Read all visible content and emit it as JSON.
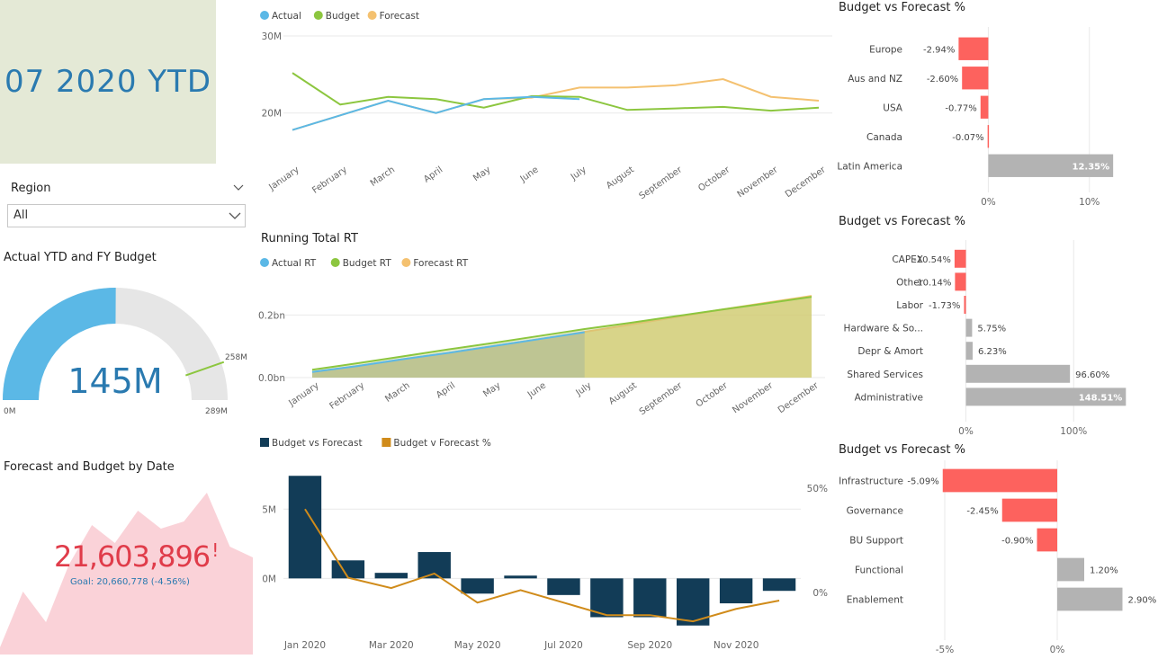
{
  "ytd_card": {
    "text": "07 2020 YTD"
  },
  "slicer": {
    "label": "Region",
    "value": "All"
  },
  "gauge": {
    "title": "Actual YTD and FY Budget",
    "value_label": "145M",
    "value": 145,
    "target": 258,
    "min": 0,
    "max": 289,
    "min_label": "0M",
    "max_label": "289M",
    "target_label": "258M",
    "colors": {
      "fill": "#5bb8e6",
      "track": "#e6e6e6",
      "target": "#8cc63f",
      "text": "#2a7ab0"
    }
  },
  "kpi": {
    "title": "Forecast and Budget by Date",
    "value": "21,603,896",
    "indicator": "!",
    "goal": "Goal: 20,660,778 (-4.56%)",
    "trend": [
      0.04,
      0.35,
      0.18,
      0.5,
      0.72,
      0.62,
      0.8,
      0.7,
      0.74,
      0.9,
      0.6,
      0.54
    ],
    "colors": {
      "value": "#e03c4a",
      "goal": "#2a7ab0",
      "area": "#fad2d8"
    }
  },
  "chart_data": [
    {
      "id": "monthly-line",
      "type": "line",
      "categories": [
        "January",
        "February",
        "March",
        "April",
        "May",
        "June",
        "July",
        "August",
        "September",
        "October",
        "November",
        "December"
      ],
      "series": [
        {
          "name": "Actual",
          "color": "#5bb8e6",
          "values": [
            17.8,
            19.7,
            21.6,
            20.0,
            21.8,
            22.1,
            21.8,
            null,
            null,
            null,
            null,
            null
          ]
        },
        {
          "name": "Budget",
          "color": "#8cc63f",
          "values": [
            25.2,
            21.1,
            22.1,
            21.8,
            20.7,
            22.2,
            22.1,
            20.4,
            20.6,
            20.8,
            20.3,
            20.7
          ]
        },
        {
          "name": "Forecast",
          "color": "#f4c170",
          "values": [
            17.8,
            19.7,
            21.6,
            20.0,
            21.8,
            22.0,
            23.3,
            23.3,
            23.6,
            24.4,
            22.1,
            21.6
          ]
        }
      ],
      "yticks": [
        {
          "v": 20,
          "label": "20M"
        },
        {
          "v": 30,
          "label": "30M"
        }
      ],
      "ylim": [
        16,
        30
      ]
    },
    {
      "id": "running-total",
      "type": "area",
      "title": "Running Total RT",
      "categories": [
        "January",
        "February",
        "March",
        "April",
        "May",
        "June",
        "July",
        "August",
        "September",
        "October",
        "November",
        "December"
      ],
      "series": [
        {
          "name": "Actual RT",
          "color": "#5bb8e6",
          "values": [
            0.018,
            0.037,
            0.059,
            0.079,
            0.101,
            0.123,
            0.145,
            null,
            null,
            null,
            null,
            null
          ]
        },
        {
          "name": "Budget RT",
          "color": "#8cc63f",
          "values": [
            0.025,
            0.046,
            0.068,
            0.09,
            0.111,
            0.133,
            0.155,
            0.175,
            0.196,
            0.217,
            0.237,
            0.258
          ]
        },
        {
          "name": "Forecast RT",
          "color": "#f4c170",
          "values": [
            0.018,
            0.037,
            0.059,
            0.079,
            0.101,
            0.123,
            0.146,
            0.169,
            0.193,
            0.217,
            0.239,
            0.261
          ]
        }
      ],
      "yticks": [
        {
          "v": 0,
          "label": "0.0bn"
        },
        {
          "v": 0.2,
          "label": "0.2bn"
        }
      ],
      "ylim": [
        0,
        0.27
      ]
    },
    {
      "id": "combo",
      "type": "bar",
      "categories": [
        "Jan 2020",
        "Feb 2020",
        "Mar 2020",
        "Apr 2020",
        "May 2020",
        "Jun 2020",
        "Jul 2020",
        "Aug 2020",
        "Sep 2020",
        "Oct 2020",
        "Nov 2020",
        "Dec 2020"
      ],
      "xtick_labels": [
        "Jan 2020",
        "Mar 2020",
        "May 2020",
        "Jul 2020",
        "Sep 2020",
        "Nov 2020"
      ],
      "series": [
        {
          "name": "Budget vs Forecast",
          "color": "#123c57",
          "values": [
            7.4,
            1.3,
            0.4,
            1.9,
            -1.1,
            0.2,
            -1.2,
            -2.8,
            -2.8,
            -3.4,
            -1.8,
            -0.9
          ]
        },
        {
          "name": "Budget v Forecast %",
          "color": "#d08b1a",
          "values": [
            40,
            7,
            2,
            9,
            -5,
            1,
            -5,
            -11,
            -11,
            -14,
            -8,
            -4
          ]
        }
      ],
      "y_left_ticks": [
        {
          "v": 0,
          "label": "0M"
        },
        {
          "v": 5,
          "label": "5M"
        }
      ],
      "y_left_lim": [
        -4,
        8
      ],
      "y_right_ticks": [
        {
          "v": 0,
          "label": "0%"
        },
        {
          "v": 50,
          "label": "50%"
        }
      ],
      "y_right_lim": [
        -20,
        60
      ]
    },
    {
      "id": "region-bars",
      "type": "bar",
      "title": "Budget vs Forecast %",
      "categories": [
        "Europe",
        "Aus and NZ",
        "USA",
        "Canada",
        "Latin America"
      ],
      "values": [
        -2.94,
        -2.6,
        -0.77,
        -0.07,
        12.35
      ],
      "labels": [
        "-2.94%",
        "-2.60%",
        "-0.77%",
        "-0.07%",
        "12.35%"
      ],
      "xticks": [
        {
          "v": 0,
          "label": "0%"
        },
        {
          "v": 10,
          "label": "10%"
        }
      ],
      "xlim": [
        -5.2,
        17.5
      ]
    },
    {
      "id": "category-bars",
      "type": "bar",
      "title": "Budget vs Forecast %",
      "categories": [
        "CAPEX",
        "Other",
        "Labor",
        "Hardware & So...",
        "Depr & Amort",
        "Shared Services",
        "Administrative"
      ],
      "values": [
        -10.54,
        -10.14,
        -1.73,
        5.75,
        6.23,
        96.6,
        148.51
      ],
      "labels": [
        "-10.54%",
        "-10.14%",
        "-1.73%",
        "5.75%",
        "6.23%",
        "96.60%",
        "148.51%"
      ],
      "xticks": [
        {
          "v": 0,
          "label": "0%"
        },
        {
          "v": 100,
          "label": "100%"
        }
      ],
      "xlim": [
        -28,
        185
      ]
    },
    {
      "id": "function-bars",
      "type": "bar",
      "title": "Budget vs Forecast %",
      "categories": [
        "Infrastructure",
        "Governance",
        "BU Support",
        "Functional",
        "Enablement"
      ],
      "values": [
        -5.09,
        -2.45,
        -0.9,
        1.2,
        2.9
      ],
      "labels": [
        "-5.09%",
        "-2.45%",
        "-0.90%",
        "1.20%",
        "2.90%"
      ],
      "xticks": [
        {
          "v": -5,
          "label": "-5%"
        },
        {
          "v": 0,
          "label": "0%"
        }
      ],
      "xlim": [
        -5.4,
        4.8
      ]
    }
  ],
  "colors": {
    "negative": "#fd625e",
    "positive": "#b3b3b3",
    "grid": "#e9e9e9",
    "axis_text": "#666666"
  }
}
